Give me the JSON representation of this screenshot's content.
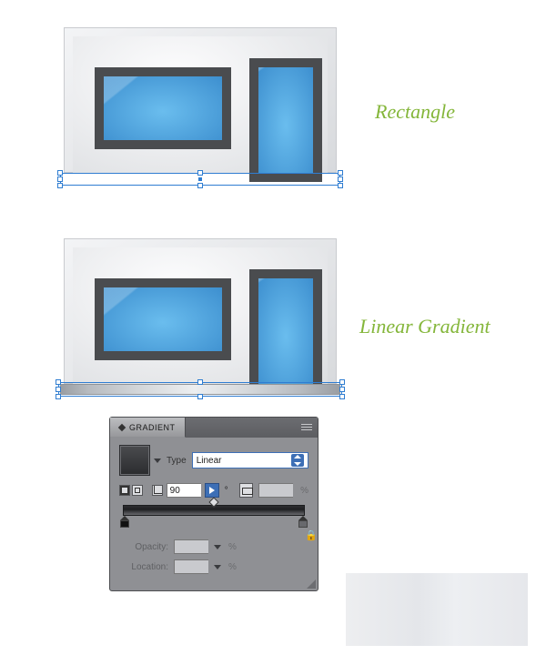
{
  "labels": {
    "rectangle": "Rectangle",
    "linear_gradient": "Linear Gradient"
  },
  "gradient_panel": {
    "title": "GRADIENT",
    "type_label": "Type",
    "type_value": "Linear",
    "angle_value": "90",
    "angle_unit": "°",
    "aspect_value": "",
    "aspect_unit": "%",
    "opacity_label": "Opacity:",
    "opacity_value": "",
    "opacity_unit": "%",
    "location_label": "Location:",
    "location_value": "",
    "location_unit": "%"
  }
}
